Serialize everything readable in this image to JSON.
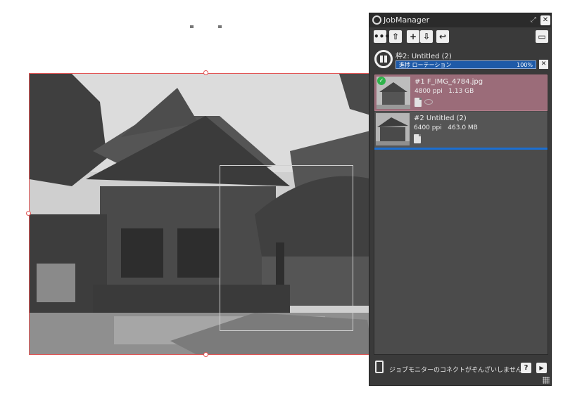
{
  "job_manager": {
    "title": "JobManager",
    "toolbar": {
      "more_label": "•••",
      "up_label": "⇧",
      "add_label": "+",
      "down_label": "⇩",
      "rotate_label": "↩",
      "clipboard_label": "▭"
    },
    "current_job": {
      "title": "枠2: Untitled (2)",
      "progress_label": "進捗 ローテーション",
      "progress_percent": "100%",
      "progress_value": 1.0
    },
    "jobs": [
      {
        "name": "#1 F_IMG_4784.jpg",
        "info": "4800 ppi   1.13 GB",
        "status": "completed"
      },
      {
        "name": "#2 Untitled (2)",
        "info": "6400 ppi   463.0 MB",
        "status": "queued"
      }
    ],
    "footer": {
      "status_text": "ジョブモニターのコネクトがぞんざいしません",
      "help_label": "?",
      "play_label": "▶"
    }
  },
  "colors": {
    "selection_border": "#e25555",
    "active_job": "#9b6c79",
    "progress_fill": "#1e5aa8",
    "panel_bg": "#3a3a3a",
    "drop_line": "#1c6fd1"
  }
}
